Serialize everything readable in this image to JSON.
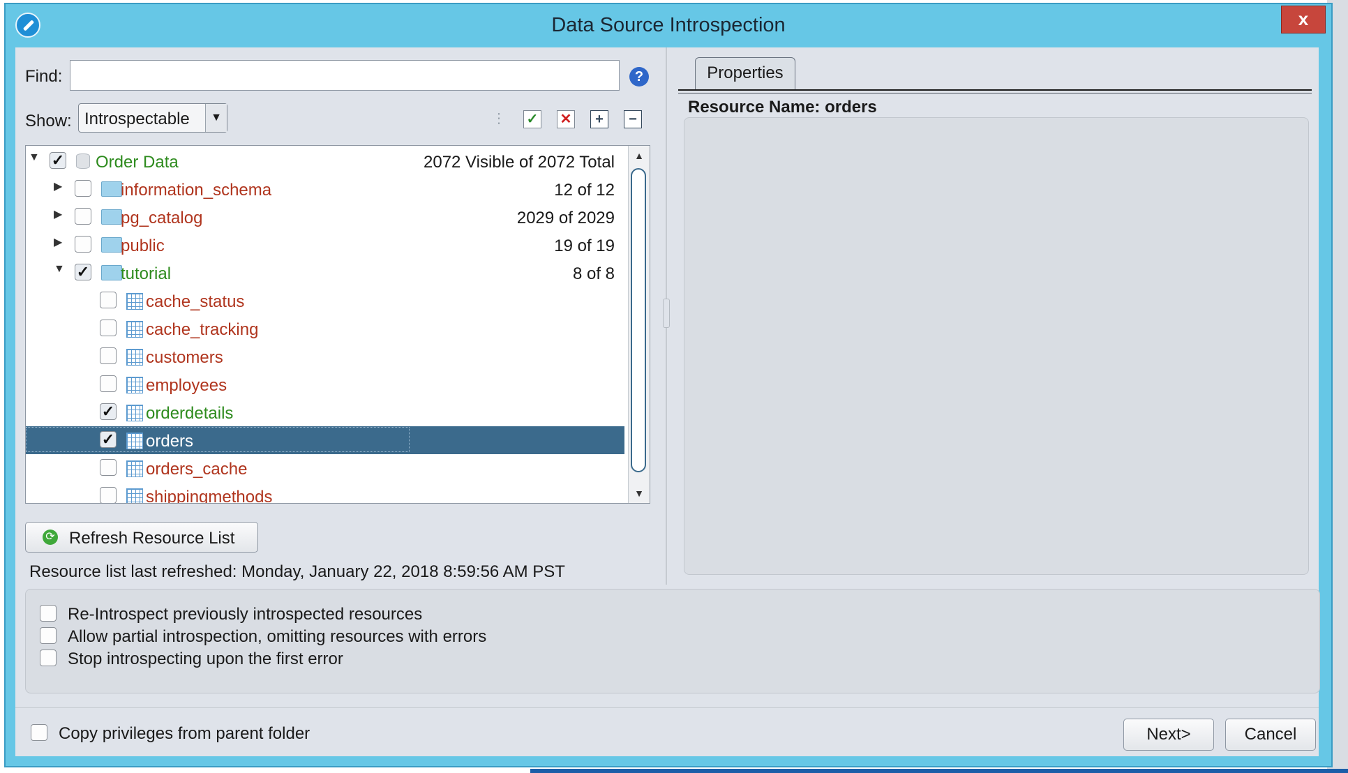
{
  "window": {
    "title": "Data Source Introspection",
    "close_glyph": "x"
  },
  "find": {
    "label": "Find:",
    "value": "",
    "help_glyph": "?"
  },
  "show": {
    "label": "Show:",
    "selected": "Introspectable"
  },
  "toolbar_icons": [
    "tree-layout-icon",
    "select-all-icon",
    "deselect-all-icon",
    "expand-all-icon",
    "collapse-all-icon"
  ],
  "tree": {
    "rows": [
      {
        "label": "Order Data",
        "count": "2072 Visible of 2072 Total",
        "checked": true,
        "color": "green",
        "icon": "database-icon",
        "expanded": true
      },
      {
        "label": "information_schema",
        "count": "12 of 12",
        "checked": false,
        "color": "red",
        "icon": "folder-icon",
        "expanded": false
      },
      {
        "label": "pg_catalog",
        "count": "2029 of 2029",
        "checked": false,
        "color": "red",
        "icon": "folder-icon",
        "expanded": false
      },
      {
        "label": "public",
        "count": "19 of 19",
        "checked": false,
        "color": "red",
        "icon": "folder-icon",
        "expanded": false
      },
      {
        "label": "tutorial",
        "count": "8 of 8",
        "checked": true,
        "color": "green",
        "icon": "folder-icon",
        "expanded": true
      },
      {
        "label": "cache_status",
        "checked": false,
        "color": "red",
        "icon": "table-icon"
      },
      {
        "label": "cache_tracking",
        "checked": false,
        "color": "red",
        "icon": "table-icon"
      },
      {
        "label": "customers",
        "checked": false,
        "color": "red",
        "icon": "table-icon"
      },
      {
        "label": "employees",
        "checked": false,
        "color": "red",
        "icon": "table-icon"
      },
      {
        "label": "orderdetails",
        "checked": true,
        "color": "green",
        "icon": "table-icon"
      },
      {
        "label": "orders",
        "checked": true,
        "color": "white",
        "icon": "table-icon",
        "selected": true
      },
      {
        "label": "orders_cache",
        "checked": false,
        "color": "red",
        "icon": "table-icon"
      },
      {
        "label": "shippingmethods",
        "checked": false,
        "color": "red",
        "icon": "table-icon"
      }
    ]
  },
  "refresh": {
    "label": "Refresh Resource List",
    "last_refreshed": "Resource list last refreshed: Monday, January 22, 2018 8:59:56 AM PST"
  },
  "properties": {
    "tab_label": "Properties",
    "resource_name": "Resource Name: orders"
  },
  "options": [
    {
      "label": "Re-Introspect previously introspected resources",
      "checked": false
    },
    {
      "label": "Allow partial introspection, omitting resources with errors",
      "checked": false
    },
    {
      "label": "Stop introspecting upon the first error",
      "checked": false
    }
  ],
  "copy_privileges": {
    "label": "Copy privileges from parent folder",
    "checked": false
  },
  "buttons": {
    "next": "Next>",
    "cancel": "Cancel"
  },
  "colors": {
    "title_bar": "#66c7e6",
    "selection": "#3b6a8c",
    "included": "#2e8b1e",
    "excluded": "#b0351e"
  }
}
